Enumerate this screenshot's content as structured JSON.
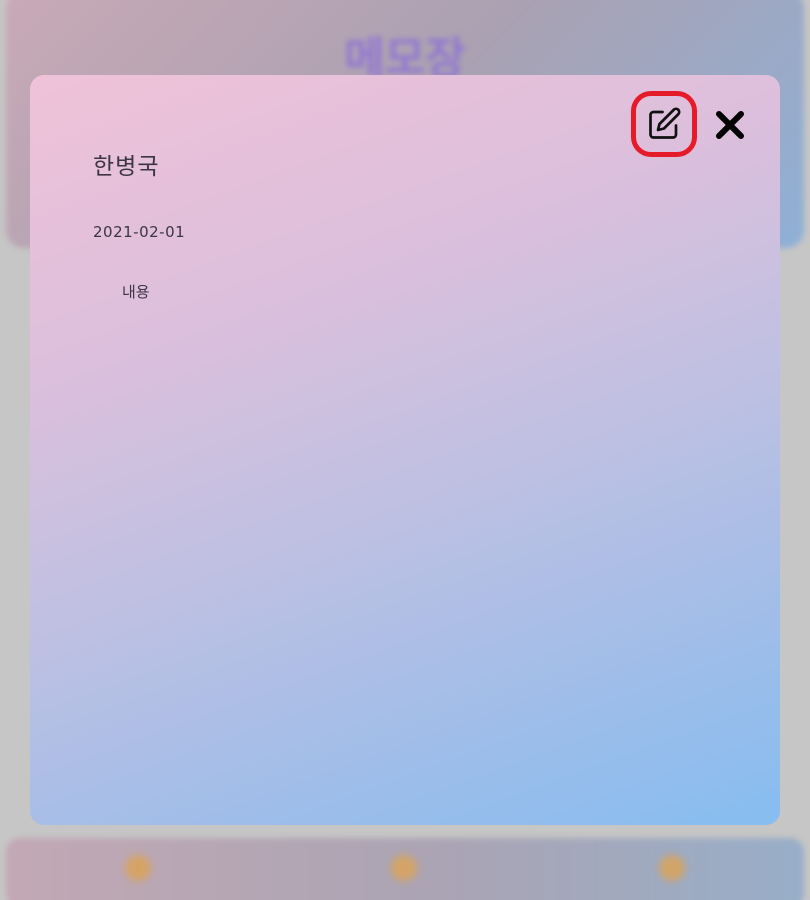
{
  "background": {
    "app_title": "메모장",
    "tab_icons": [
      "tab-icon-left",
      "tab-icon-center",
      "tab-icon-right"
    ]
  },
  "note": {
    "title": "한병국",
    "date": "2021-02-01",
    "content": "내용"
  },
  "toolbar": {
    "edit_icon": "edit-square-pencil-icon",
    "close_icon": "close-x-icon",
    "highlight_color": "#e61b2a"
  }
}
